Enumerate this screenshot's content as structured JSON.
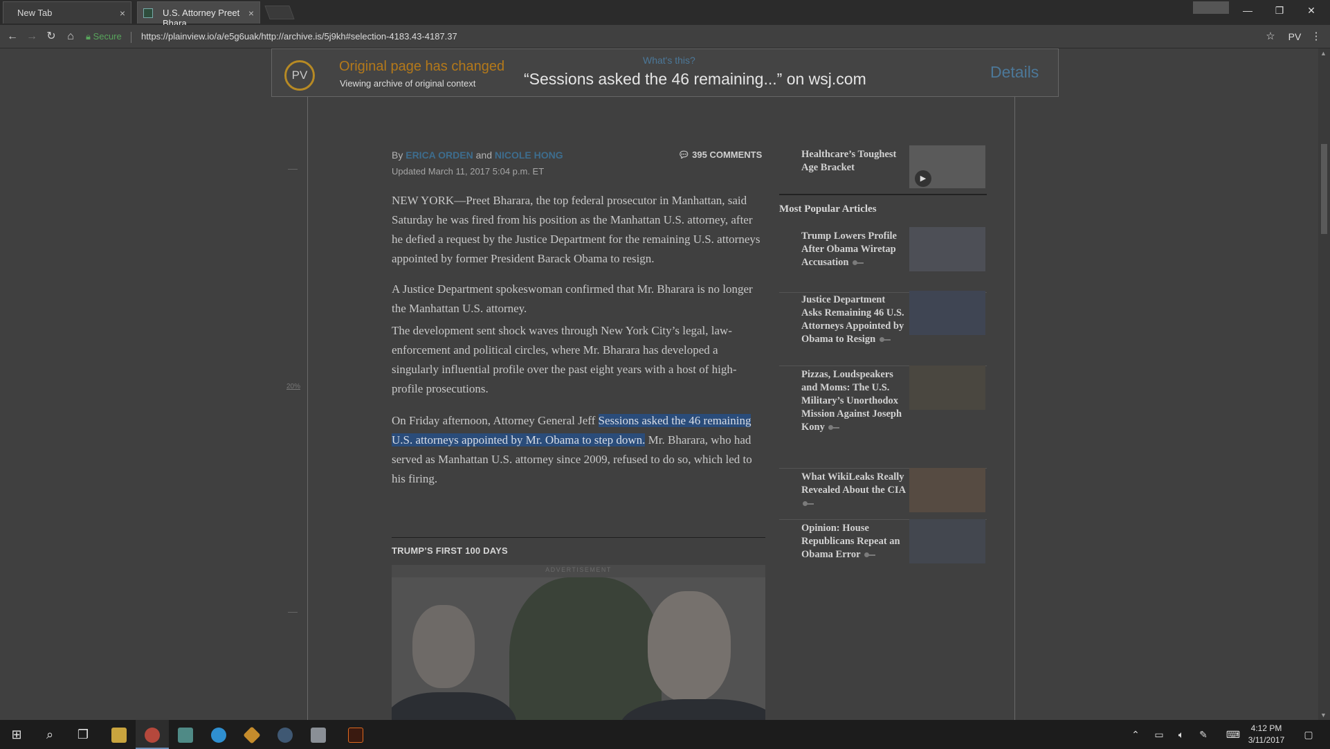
{
  "browser": {
    "tabs": [
      {
        "title": "New Tab",
        "close": "×"
      },
      {
        "title": "U.S. Attorney Preet Bhara",
        "close": "×"
      }
    ],
    "secure_label": "Secure",
    "url": "https://plainview.io/a/e5g6uak/http://archive.is/5j9kh#selection-4183.43-4187.37",
    "profile": "PV"
  },
  "pv_banner": {
    "logo": "PV",
    "changed": "Original page has changed",
    "sub": "Viewing archive of original context",
    "whats_this": "What's this?",
    "quote": "“Sessions asked the 46 remaining...” on wsj.com",
    "details": "Details"
  },
  "article": {
    "by": "By",
    "author1": "ERICA ORDEN",
    "and": "and",
    "author2": "NICOLE HONG",
    "comments": "395 COMMENTS",
    "updated": "Updated March 11, 2017 5:04 p.m. ET",
    "p1": "NEW YORK—Preet Bharara, the top federal prosecutor in Manhattan, said Saturday he was fired from his position as the Manhattan U.S. attorney, after he defied a request by the Justice Department for the remaining U.S. attorneys appointed by former President Barack Obama to resign.",
    "p2": "A Justice Department spokeswoman confirmed that Mr. Bharara is no longer the Manhattan U.S. attorney.",
    "p3": "The development sent shock waves through New York City’s legal, law-enforcement and political circles, where Mr. Bharara has developed a singularly influential profile over the past eight years with a host of high-profile prosecutions.",
    "p4_before": "On Friday afternoon, Attorney General Jeff ",
    "p4_highlight": "Sessions asked the 46 remaining U.S. attorneys appointed by Mr. Obama to step down.",
    "p4_after": " Mr. Bharara, who had served as Manhattan U.S. attorney since 2009, refused to do so, which led to his firing.",
    "section": "TRUMP’S FIRST 100 DAYS",
    "ad_label": "ADVERTISEMENT",
    "margin_pct": "20%"
  },
  "sidebar": {
    "top_item": "Healthcare’s Toughest Age Bracket",
    "heading": "Most Popular Articles",
    "items": [
      {
        "title": "Trump Lowers Profile After Obama Wiretap Accusation"
      },
      {
        "title": "Justice Department Asks Remaining 46 U.S. Attorneys Appointed by Obama to Resign"
      },
      {
        "title": "Pizzas, Loudspeakers and Moms: The U.S. Military’s Unorthodox Mission Against Joseph Kony"
      },
      {
        "title": "What WikiLeaks Really Revealed About the CIA"
      },
      {
        "title": "Opinion: House Republicans Repeat an Obama Error"
      }
    ]
  },
  "taskbar": {
    "time": "4:12 PM",
    "date": "3/11/2017"
  }
}
